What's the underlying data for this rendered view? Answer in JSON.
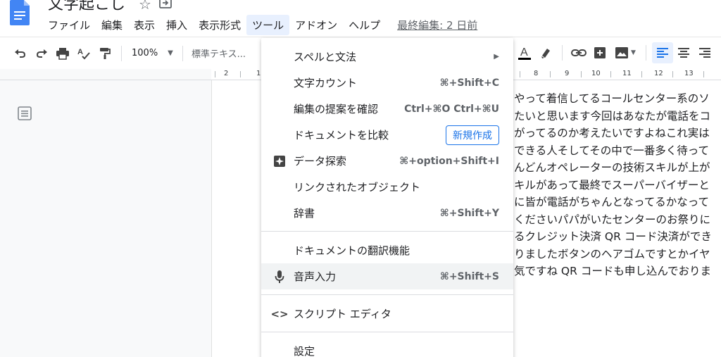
{
  "document": {
    "title": "文字起こし",
    "last_edit": "最終編集: 2 日前"
  },
  "menubar": {
    "items": [
      "ファイル",
      "編集",
      "表示",
      "挿入",
      "表示形式",
      "ツール",
      "アドオン",
      "ヘルプ"
    ],
    "active": "ツール"
  },
  "toolbar": {
    "zoom": "100%",
    "style": "標準テキス..."
  },
  "ruler": {
    "labels": [
      "2",
      "1",
      "8",
      "9",
      "10",
      "11",
      "12",
      "13"
    ]
  },
  "tools_menu": {
    "spelling": "スペルと文法",
    "word_count": "文字カウント",
    "word_count_shortcut": "⌘+Shift+C",
    "review_suggestions": "編集の提案を確認",
    "review_suggestions_shortcut": "Ctrl+⌘O Ctrl+⌘U",
    "compare": "ドキュメントを比較",
    "compare_badge": "新規作成",
    "explore": "データ探索",
    "explore_shortcut": "⌘+option+Shift+I",
    "linked_objects": "リンクされたオブジェクト",
    "dictionary": "辞書",
    "dictionary_shortcut": "⌘+Shift+Y",
    "translate": "ドキュメントの翻訳機能",
    "voice_typing": "音声入力",
    "voice_typing_shortcut": "⌘+Shift+S",
    "script_editor": "スクリプト エディタ",
    "preferences": "設定"
  },
  "body_lines": [
    "やって着信してるコールセンター系のソ",
    "たいと思います今回はあなたが電話をコ",
    "がってるのか考えたいですよねこれ実は",
    "できる人そしてその中で一番多く待って",
    "んどんオペレーターの技術スキルが上が",
    "キルがあって最終でスーパーバイザーと",
    "に皆が電話がちゃんとなってるかなって",
    "くださいパパがいたセンターのお祭りに",
    "るクレジット決済 QR コード決済ができ",
    "りましたボタンのヘアゴムですとかイヤ",
    "気ですね QR コードも申し込んでおりま"
  ],
  "colors": {
    "accent": "#1a73e8",
    "menu_active_bg": "#e8f0fe",
    "hover_bg": "#f1f3f4",
    "docs_blue": "#4285f4"
  }
}
